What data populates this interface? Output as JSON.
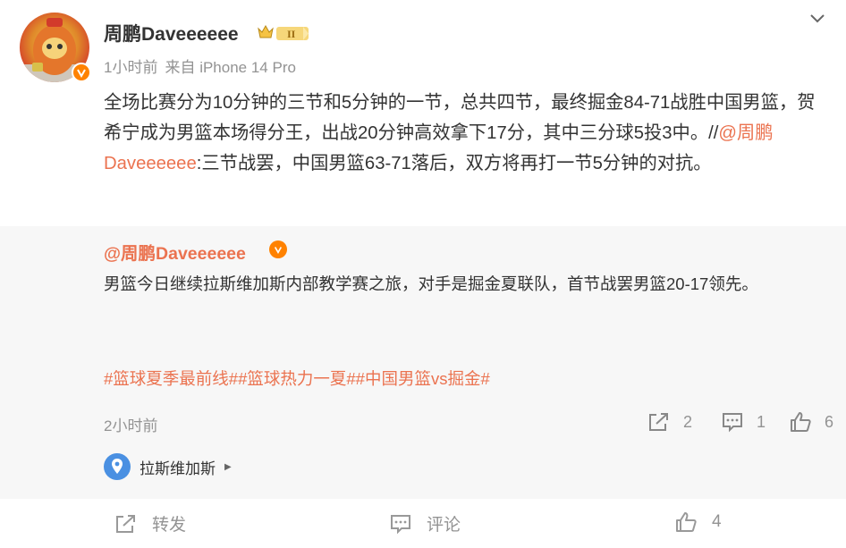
{
  "author": {
    "name": "周鹏Daveeeeee",
    "rank_badge": "II",
    "time": "1小时前",
    "source": "来自 iPhone 14 Pro"
  },
  "post": {
    "text_main": "全场比赛分为10分钟的三节和5分钟的一节，总共四节，最终掘金84-71战胜中国男篮，贺希宁成为男篮本场得分王，出战20分钟高效拿下17分，其中三分球5投3中。//",
    "mention": "@周鹏Daveeeeee",
    "text_tail": ":三节战罢，中国男篮63-71落后，双方将再打一节5分钟的对抗。"
  },
  "repost": {
    "author": "@周鹏Daveeeeee",
    "text": "男篮今日继续拉斯维加斯内部教学赛之旅，对手是掘金夏联队，首节战罢男篮20-17领先。",
    "topics": "#篮球夏季最前线##篮球热力一夏##中国男篮vs掘金#",
    "time": "2小时前",
    "stats": {
      "reposts": "2",
      "comments": "1",
      "likes": "6"
    },
    "location": "拉斯维加斯"
  },
  "actions": {
    "repost_label": "转发",
    "comment_label": "评论",
    "likes": "4"
  },
  "colors": {
    "accent": "#eb7350",
    "verified": "#ff8200",
    "location_icon": "#4a90e2",
    "muted": "#939393",
    "repost_bg": "#f7f7f7"
  },
  "icons": [
    "verified-icon",
    "rank-crown-icon",
    "chevron-down-icon",
    "share-icon",
    "comment-icon",
    "thumbs-up-icon",
    "location-pin-icon"
  ]
}
